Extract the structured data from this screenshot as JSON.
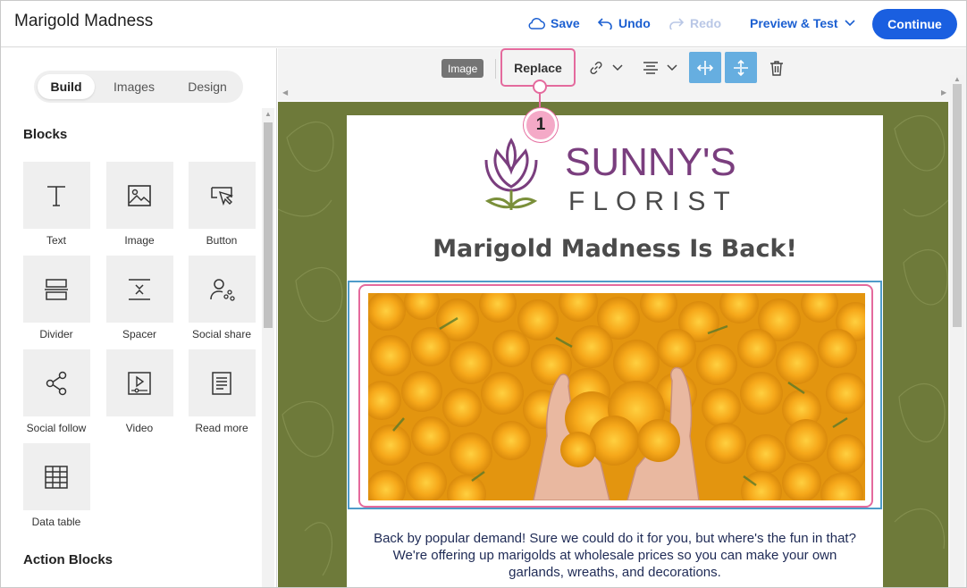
{
  "header": {
    "title": "Marigold Madness",
    "save_label": "Save",
    "undo_label": "Undo",
    "redo_label": "Redo",
    "preview_label": "Preview & Test",
    "continue_label": "Continue"
  },
  "sidebar": {
    "tabs": [
      {
        "label": "Build",
        "active": true
      },
      {
        "label": "Images",
        "active": false
      },
      {
        "label": "Design",
        "active": false
      }
    ],
    "blocks_title": "Blocks",
    "blocks": [
      {
        "label": "Text",
        "icon": "text-icon"
      },
      {
        "label": "Image",
        "icon": "image-icon"
      },
      {
        "label": "Button",
        "icon": "button-icon"
      },
      {
        "label": "Divider",
        "icon": "divider-icon"
      },
      {
        "label": "Spacer",
        "icon": "spacer-icon"
      },
      {
        "label": "Social share",
        "icon": "social-share-icon"
      },
      {
        "label": "Social follow",
        "icon": "social-follow-icon"
      },
      {
        "label": "Video",
        "icon": "video-icon"
      },
      {
        "label": "Read more",
        "icon": "read-more-icon"
      },
      {
        "label": "Data table",
        "icon": "data-table-icon"
      }
    ],
    "action_blocks_title": "Action Blocks"
  },
  "toolbar": {
    "element_chip": "Image",
    "replace_label": "Replace",
    "icons": [
      "link-icon",
      "align-icon",
      "fit-width-icon",
      "fit-height-icon",
      "trash-icon"
    ]
  },
  "callout": {
    "number": "1"
  },
  "email": {
    "logo_line1": "SUNNY'S",
    "logo_line2": "FLORIST",
    "headline": "Marigold Madness Is Back!",
    "body": "Back by popular demand! Sure we could do it for you, but where's the fun in that? We're offering up marigolds at wholesale prices so you can make your own garlands, wreaths, and decorations."
  },
  "colors": {
    "accent": "#1a5fe0",
    "highlight": "#e46a9d",
    "selection": "#4e9bc9",
    "canvas_bg": "#6e7a3a",
    "logo_purple": "#7a3e7e"
  }
}
